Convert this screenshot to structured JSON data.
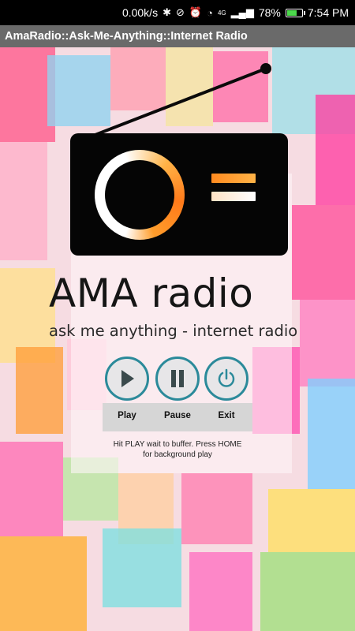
{
  "status_bar": {
    "network_speed": "0.00k/s",
    "signal_label": "4G",
    "battery_percent": "78%",
    "battery_level": 0.78,
    "time": "7:54 PM",
    "icons": [
      "bluetooth-icon",
      "mute-notifications-icon",
      "alarm-icon",
      "wifi-icon",
      "signal-icon",
      "battery-icon"
    ]
  },
  "app": {
    "title": "AmaRadio::Ask-Me-Anything::Internet Radio"
  },
  "logo": {
    "brand": "AMA radio",
    "tagline": "ask me anything - internet radio",
    "colors": {
      "body": "#050505",
      "accent": "#ff8a1f"
    }
  },
  "controls": {
    "play_label": "Play",
    "pause_label": "Pause",
    "exit_label": "Exit",
    "ring_color": "#2b8a9a"
  },
  "hint": {
    "line1": "Hit PLAY wait to buffer. Press HOME",
    "line2": "for background play"
  }
}
